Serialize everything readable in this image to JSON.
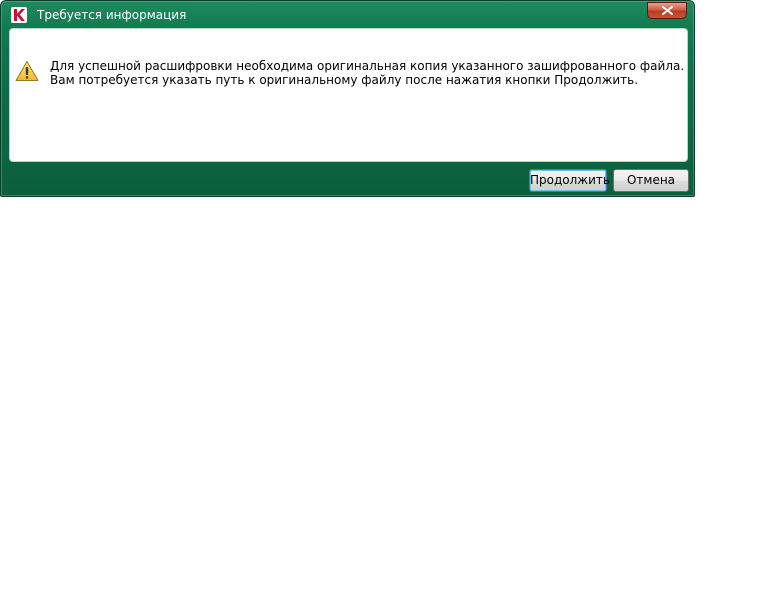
{
  "window": {
    "title": "Требуется информация",
    "app_icon": "kaspersky-k-icon",
    "close_icon": "close-icon"
  },
  "message": {
    "icon": "warning-icon",
    "line1": "Для успешной расшифровки необходима оригинальная копия указанного зашифрованного файла.",
    "line2": "Вам потребуется указать путь к оригинальному файлу после нажатия кнопки Продолжить."
  },
  "buttons": {
    "continue_label": "Продолжить",
    "cancel_label": "Отмена"
  },
  "colors": {
    "frame_green": "#0f6f48",
    "close_red": "#c9553c",
    "icon_red": "#c8102e"
  }
}
